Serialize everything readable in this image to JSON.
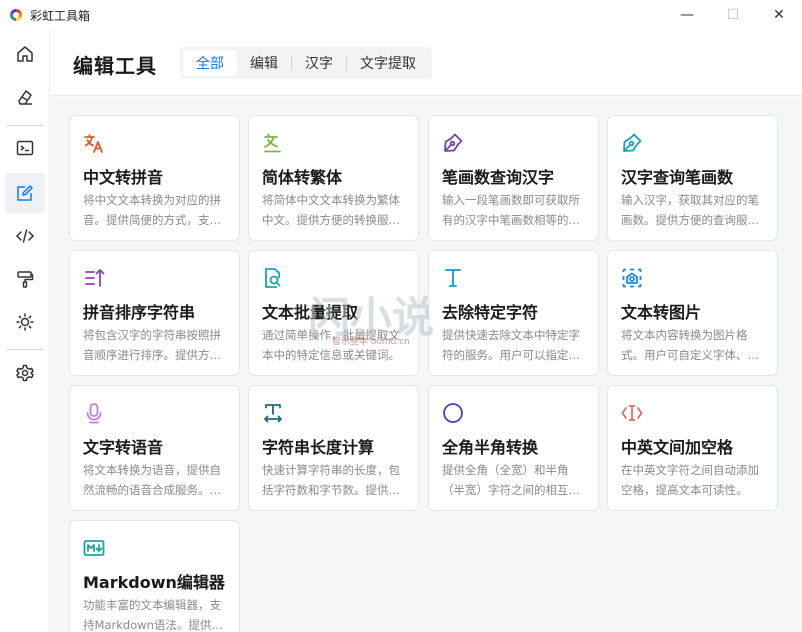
{
  "window": {
    "title": "彩虹工具箱",
    "minimize_icon": "—",
    "maximize_icon": "☐",
    "close_icon": "✕"
  },
  "sidebar": {
    "items": [
      {
        "icon": "home-icon"
      },
      {
        "icon": "eraser-icon"
      },
      {
        "icon": "terminal-icon"
      },
      {
        "icon": "edit-icon",
        "active": true
      },
      {
        "icon": "code-icon"
      },
      {
        "icon": "paint-roller-icon"
      },
      {
        "icon": "sun-icon"
      },
      {
        "icon": "settings-icon"
      }
    ]
  },
  "header": {
    "title": "编辑工具",
    "tabs": [
      "全部",
      "编辑",
      "汉字",
      "文字提取"
    ],
    "active_tab": 0,
    "accent": "#1677ff"
  },
  "cards": [
    {
      "icon": "translate-icon",
      "color": "#e8542f",
      "title": "中文转拼音",
      "desc": "将中文文本转换为对应的拼音。提供简便的方式，支持多种拼音格式输出。"
    },
    {
      "icon": "translate-alt-icon",
      "color": "#7cb342",
      "title": "简体转繁体",
      "desc": "将简体中文文本转换为繁体中文。提供方便的转换服务。"
    },
    {
      "icon": "pen-nib-icon",
      "color": "#7b3fa0",
      "title": "笔画数查询汉字",
      "desc": "输入一段笔画数即可获取所有的汉字中笔画数相等的汉字。"
    },
    {
      "icon": "pen-nib-icon",
      "color": "#17a2b8",
      "title": "汉字查询笔画数",
      "desc": "输入汉字，获取其对应的笔画数。提供方便的查询服务。"
    },
    {
      "icon": "sort-icon",
      "color": "#8e44ad",
      "title": "拼音排序字符串",
      "desc": "将包含汉字的字符串按照拼音顺序进行排序。提供方便的排序功能。"
    },
    {
      "icon": "file-search-icon",
      "color": "#17a2b8",
      "title": "文本批量提取",
      "desc": "通过简单操作，批量提取文本中的特定信息或关键词。"
    },
    {
      "icon": "text-t-icon",
      "color": "#29a3d6",
      "title": "去除特定字符",
      "desc": "提供快速去除文本中特定字符的服务。用户可以指定要去除的字符。"
    },
    {
      "icon": "image-icon",
      "color": "#1e88e5",
      "title": "文本转图片",
      "desc": "将文本内容转换为图片格式。用户可自定义字体、颜色等样式。"
    },
    {
      "icon": "microphone-icon",
      "color": "#b97fe0",
      "title": "文字转语音",
      "desc": "将文本转换为语音，提供自然流畅的语音合成服务。支持多种声音。"
    },
    {
      "icon": "text-width-icon",
      "color": "#1b6e7a",
      "title": "字符串长度计算",
      "desc": "快速计算字符串的长度，包括字符数和字节数。提供便捷的统计。"
    },
    {
      "icon": "half-moon-icon",
      "color": "#4a3fc8",
      "title": "全角半角转换",
      "desc": "提供全角（全宽）和半角（半宽）字符之间的相互转换服务。"
    },
    {
      "icon": "text-cursor-icon",
      "color": "#e06b6b",
      "title": "中英文间加空格",
      "desc": "在中英文字符之间自动添加空格，提高文本可读性。"
    },
    {
      "icon": "markdown-icon",
      "color": "#1ba39c",
      "title": "Markdown编辑器",
      "desc": "功能丰富的文本编辑器，支持Markdown语法。提供实时预览功能。"
    }
  ],
  "watermark": {
    "text": "闪小说",
    "subtext": "音乐整本 oomd.cn"
  }
}
